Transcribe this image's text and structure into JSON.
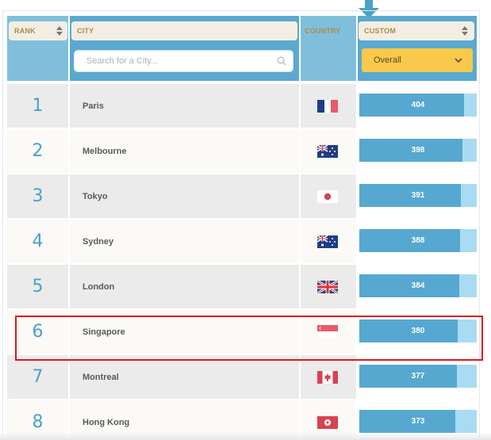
{
  "header": {
    "rank_label": "RANK",
    "city_label": "CITY",
    "country_label": "COUNTRY",
    "custom_label": "CUSTOM"
  },
  "search": {
    "placeholder": "Search for a City..."
  },
  "filter": {
    "selected": "Overall"
  },
  "colors": {
    "accent_blue": "#57a8d0",
    "bar_track": "#a9dbf2",
    "select_yellow": "#f8c94a",
    "header_text": "#b08a46",
    "highlight_red": "#e3151d"
  },
  "rows": [
    {
      "rank": "1",
      "city": "Paris",
      "country_flag": "france-flag-icon",
      "score": "404"
    },
    {
      "rank": "2",
      "city": "Melbourne",
      "country_flag": "australia-flag-icon",
      "score": "398"
    },
    {
      "rank": "3",
      "city": "Tokyo",
      "country_flag": "japan-flag-icon",
      "score": "391"
    },
    {
      "rank": "4",
      "city": "Sydney",
      "country_flag": "australia-flag-icon",
      "score": "388"
    },
    {
      "rank": "5",
      "city": "London",
      "country_flag": "uk-flag-icon",
      "score": "384"
    },
    {
      "rank": "6",
      "city": "Singapore",
      "country_flag": "singapore-flag-icon",
      "score": "380"
    },
    {
      "rank": "7",
      "city": "Montreal",
      "country_flag": "canada-flag-icon",
      "score": "377"
    },
    {
      "rank": "8",
      "city": "Hong Kong",
      "country_flag": "hongkong-flag-icon",
      "score": "373"
    }
  ],
  "highlighted_rank": "6"
}
